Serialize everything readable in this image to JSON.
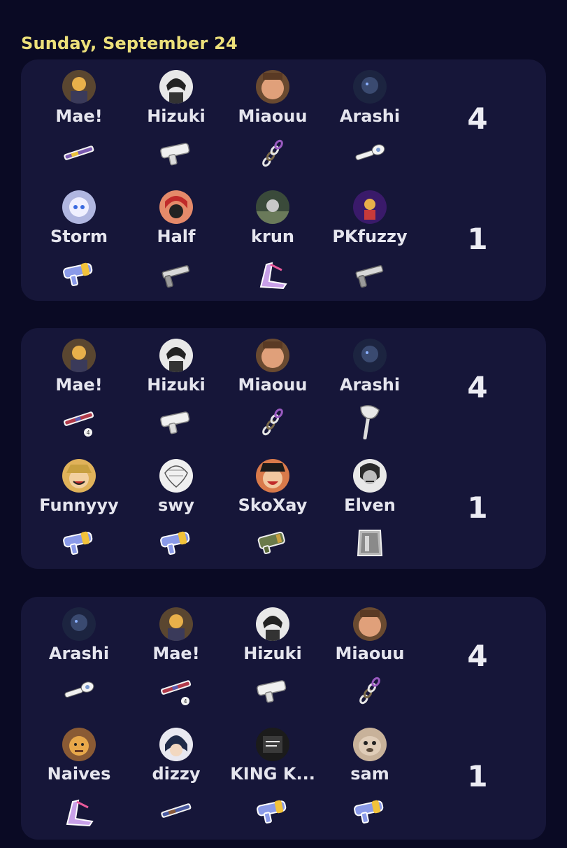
{
  "date": "Sunday, September 24",
  "matches": [
    {
      "teams": [
        {
          "score": "4",
          "players": [
            {
              "name": "Mae!",
              "avatar_color": "#b68a4e",
              "weapon": "rifle-icon"
            },
            {
              "name": "Hizuki",
              "avatar_color": "#d9d9d9",
              "weapon": "blaster-icon"
            },
            {
              "name": "Miaouu",
              "avatar_color": "#c98a64",
              "weapon": "chain-launcher-icon"
            },
            {
              "name": "Arashi",
              "avatar_color": "#2c3a5c",
              "weapon": "roller-gun-icon"
            }
          ]
        },
        {
          "score": "1",
          "players": [
            {
              "name": "Storm",
              "avatar_color": "#cfd3f0",
              "weapon": "squirt-gun-icon"
            },
            {
              "name": "Half",
              "avatar_color": "#e58a6a",
              "weapon": "pistol-icon"
            },
            {
              "name": "krun",
              "avatar_color": "#5c6a5a",
              "weapon": "slingshot-icon"
            },
            {
              "name": "PKfuzzy",
              "avatar_color": "#4a2a7a",
              "weapon": "pistol-icon"
            }
          ]
        }
      ]
    },
    {
      "teams": [
        {
          "score": "4",
          "players": [
            {
              "name": "Mae!",
              "avatar_color": "#b68a4e",
              "weapon": "red-rifle-icon"
            },
            {
              "name": "Hizuki",
              "avatar_color": "#d9d9d9",
              "weapon": "blaster-icon"
            },
            {
              "name": "Miaouu",
              "avatar_color": "#c98a64",
              "weapon": "chain-launcher-icon"
            },
            {
              "name": "Arashi",
              "avatar_color": "#2c3a5c",
              "weapon": "axe-icon"
            }
          ]
        },
        {
          "score": "1",
          "players": [
            {
              "name": "Funnyyy",
              "avatar_color": "#e0b25a",
              "weapon": "squirt-gun-icon"
            },
            {
              "name": "swy",
              "avatar_color": "#e6e6e6",
              "weapon": "squirt-gun-icon"
            },
            {
              "name": "SkoXay",
              "avatar_color": "#d97a4a",
              "weapon": "grenade-launcher-icon"
            },
            {
              "name": "Elven",
              "avatar_color": "#9a9a9a",
              "weapon": "shield-icon"
            }
          ]
        }
      ]
    },
    {
      "teams": [
        {
          "score": "4",
          "players": [
            {
              "name": "Arashi",
              "avatar_color": "#2c3a5c",
              "weapon": "roller-gun-icon"
            },
            {
              "name": "Mae!",
              "avatar_color": "#b68a4e",
              "weapon": "red-rifle-icon"
            },
            {
              "name": "Hizuki",
              "avatar_color": "#d9d9d9",
              "weapon": "blaster-icon"
            },
            {
              "name": "Miaouu",
              "avatar_color": "#c98a64",
              "weapon": "chain-launcher-icon"
            }
          ]
        },
        {
          "score": "1",
          "players": [
            {
              "name": "Naives",
              "avatar_color": "#8a5a34",
              "weapon": "slingshot-icon"
            },
            {
              "name": "dizzy",
              "avatar_color": "#2a3450",
              "weapon": "rifle-icon"
            },
            {
              "name": "KING K...",
              "avatar_color": "#1b1b1b",
              "weapon": "squirt-gun-icon"
            },
            {
              "name": "sam",
              "avatar_color": "#c8b29a",
              "weapon": "squirt-gun-icon"
            }
          ]
        }
      ]
    }
  ]
}
